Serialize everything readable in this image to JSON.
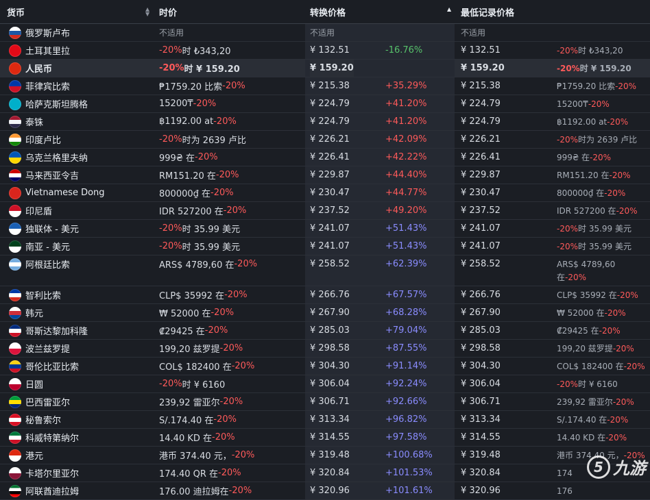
{
  "header": {
    "currency": "货币",
    "price": "时价",
    "converted": "转换价格",
    "lowest": "最低记录价格"
  },
  "rows": [
    {
      "name": "俄罗斯卢布",
      "price": "不适用",
      "converted": "不适用",
      "pct": "",
      "low": "不适用",
      "lowprice": "",
      "flag": "flag-russia",
      "flagcolors": [
        "#ffffff",
        "#1c57a5",
        "#d52b1e"
      ],
      "type": "na"
    },
    {
      "name": "土耳其里拉",
      "price_pct": "-20%",
      "price_rest": "时 ₺343,20",
      "converted": "¥ 132.51",
      "pct": "-16.76%",
      "pctclass": "green",
      "low": "¥ 132.51",
      "lowprice_pct": "-20%",
      "lowprice_rest": "时 ₺343,20",
      "flag": "flag-turkey",
      "flagcolors": [
        "#e30a17"
      ],
      "order": "pct-first"
    },
    {
      "name": "人民币",
      "price_pct": "-20%",
      "price_rest": "时 ¥ 159.20",
      "converted": "¥ 159.20",
      "pct": "",
      "pctclass": "",
      "low": "¥ 159.20",
      "lowprice_pct": "-20%",
      "lowprice_rest": "时 ¥ 159.20",
      "flag": "flag-china",
      "flagcolors": [
        "#de2910"
      ],
      "order": "pct-first",
      "highlight": true
    },
    {
      "name": "菲律宾比索",
      "price_rest": "₱1759.20 比索",
      "price_pct": "-20%",
      "converted": "¥ 215.38",
      "pct": "+35.29%",
      "pctclass": "red",
      "low": "¥ 215.38",
      "lowprice_rest": "₱1759.20 比索",
      "lowprice_pct": "-20%",
      "flag": "flag-philippines",
      "flagcolors": [
        "#0038a8",
        "#ce1126"
      ],
      "order": "pct-last"
    },
    {
      "name": "哈萨克斯坦腾格",
      "price_rest": "15200₸ ",
      "price_pct": "-20%",
      "converted": "¥ 224.79",
      "pct": "+41.20%",
      "pctclass": "red",
      "low": "¥ 224.79",
      "lowprice_rest": "15200₸ ",
      "lowprice_pct": "-20%",
      "flag": "flag-kazakhstan",
      "flagcolors": [
        "#00afca"
      ],
      "order": "pct-last"
    },
    {
      "name": "泰铢",
      "price_rest": "฿1192.00 at ",
      "price_pct": "-20%",
      "converted": "¥ 224.79",
      "pct": "+41.20%",
      "pctclass": "red",
      "low": "¥ 224.79",
      "lowprice_rest": "฿1192.00 at ",
      "lowprice_pct": "-20%",
      "flag": "flag-thailand",
      "flagcolors": [
        "#a51931",
        "#f4f5f8",
        "#2d2a4a"
      ],
      "order": "pct-last"
    },
    {
      "name": "印度卢比",
      "price_pct": "-20%",
      "price_rest": "时为 2639 卢比",
      "converted": "¥ 226.21",
      "pct": "+42.09%",
      "pctclass": "red",
      "low": "¥ 226.21",
      "lowprice_pct": "-20%",
      "lowprice_rest": "时为 2639 卢比",
      "flag": "flag-india",
      "flagcolors": [
        "#ff9933",
        "#ffffff",
        "#138808"
      ],
      "order": "pct-first"
    },
    {
      "name": "乌克兰格里夫纳",
      "price_rest": "999₴ 在",
      "price_pct": "-20%",
      "converted": "¥ 226.41",
      "pct": "+42.22%",
      "pctclass": "red",
      "low": "¥ 226.41",
      "lowprice_rest": "999₴ 在",
      "lowprice_pct": "-20%",
      "flag": "flag-ukraine",
      "flagcolors": [
        "#0057b7",
        "#ffd700"
      ],
      "order": "pct-last"
    },
    {
      "name": "马来西亚令吉",
      "price_rest": "RM151.20 在",
      "price_pct": "-20%",
      "converted": "¥ 229.87",
      "pct": "+44.40%",
      "pctclass": "red",
      "low": "¥ 229.87",
      "lowprice_rest": "RM151.20 在",
      "lowprice_pct": "-20%",
      "flag": "flag-malaysia",
      "flagcolors": [
        "#cc0001",
        "#ffffff",
        "#010066"
      ],
      "order": "pct-last"
    },
    {
      "name": "Vietnamese Dong",
      "price_rest": "800000₫ 在",
      "price_pct": "-20%",
      "converted": "¥ 230.47",
      "pct": "+44.77%",
      "pctclass": "red",
      "low": "¥ 230.47",
      "lowprice_rest": "800000₫ 在",
      "lowprice_pct": "-20%",
      "flag": "flag-vietnam",
      "flagcolors": [
        "#da251d"
      ],
      "order": "pct-last"
    },
    {
      "name": "印尼盾",
      "price_rest": "IDR 527200 在",
      "price_pct": "-20%",
      "converted": "¥ 237.52",
      "pct": "+49.20%",
      "pctclass": "red",
      "low": "¥ 237.52",
      "lowprice_rest": "IDR 527200 在",
      "lowprice_pct": "-20%",
      "flag": "flag-indonesia",
      "flagcolors": [
        "#ce1126",
        "#ffffff"
      ],
      "order": "pct-last"
    },
    {
      "name": "独联体 - 美元",
      "price_pct": "-20%",
      "price_rest": "时 35.99 美元",
      "converted": "¥ 241.07",
      "pct": "+51.43%",
      "pctclass": "blue",
      "low": "¥ 241.07",
      "lowprice_pct": "-20%",
      "lowprice_rest": "时 35.99 美元",
      "flag": "flag-cis",
      "flagcolors": [
        "#1a5fb4",
        "#ffffff"
      ],
      "order": "pct-first"
    },
    {
      "name": "南亚 - 美元",
      "price_pct": "-20%",
      "price_rest": "时 35.99 美元",
      "converted": "¥ 241.07",
      "pct": "+51.43%",
      "pctclass": "blue",
      "low": "¥ 241.07",
      "lowprice_pct": "-20%",
      "lowprice_rest": "时 35.99 美元",
      "flag": "flag-south-asia",
      "flagcolors": [
        "#01411c",
        "#ffffff"
      ],
      "order": "pct-first"
    },
    {
      "name": "阿根廷比索",
      "price_rest": "ARS$ 4789,60 在",
      "price_pct": "-20%",
      "converted": "¥ 258.52",
      "pct": "+62.39%",
      "pctclass": "blue",
      "low": "¥ 258.52",
      "lowprice_rest": "ARS$ 4789,60 在",
      "lowprice_pct": "-20%",
      "flag": "flag-argentina",
      "flagcolors": [
        "#74acdf",
        "#ffffff",
        "#74acdf"
      ],
      "order": "pct-last",
      "tall": true
    },
    {
      "name": "智利比索",
      "price_rest": "CLP$ 35992 在",
      "price_pct": "-20%",
      "converted": "¥ 266.76",
      "pct": "+67.57%",
      "pctclass": "blue",
      "low": "¥ 266.76",
      "lowprice_rest": "CLP$ 35992 在",
      "lowprice_pct": "-20%",
      "flag": "flag-chile",
      "flagcolors": [
        "#0039a6",
        "#ffffff",
        "#d52b1e"
      ],
      "order": "pct-last"
    },
    {
      "name": "韩元",
      "price_rest": "₩ 52000 在",
      "price_pct": "-20%",
      "converted": "¥ 267.90",
      "pct": "+68.28%",
      "pctclass": "blue",
      "low": "¥ 267.90",
      "lowprice_rest": "₩ 52000 在",
      "lowprice_pct": "-20%",
      "flag": "flag-korea",
      "flagcolors": [
        "#ffffff",
        "#cd2e3a",
        "#0047a0"
      ],
      "order": "pct-last"
    },
    {
      "name": "哥斯达黎加科隆",
      "price_rest": "₡29425 在",
      "price_pct": "-20%",
      "converted": "¥ 285.03",
      "pct": "+79.04%",
      "pctclass": "blue",
      "low": "¥ 285.03",
      "lowprice_rest": "₡29425 在",
      "lowprice_pct": "-20%",
      "flag": "flag-costa-rica",
      "flagcolors": [
        "#002b7f",
        "#ffffff",
        "#ce1126"
      ],
      "order": "pct-last"
    },
    {
      "name": "波兰兹罗提",
      "price_rest": "199,20 兹罗提",
      "price_pct": "-20%",
      "converted": "¥ 298.58",
      "pct": "+87.55%",
      "pctclass": "blue",
      "low": "¥ 298.58",
      "lowprice_rest": "199,20 兹罗提",
      "lowprice_pct": "-20%",
      "flag": "flag-poland",
      "flagcolors": [
        "#ffffff",
        "#dc143c"
      ],
      "order": "pct-last"
    },
    {
      "name": "哥伦比亚比索",
      "price_rest": "COL$ 182400 在",
      "price_pct": "-20%",
      "converted": "¥ 304.30",
      "pct": "+91.14%",
      "pctclass": "blue",
      "low": "¥ 304.30",
      "lowprice_rest": "COL$ 182400 在",
      "lowprice_pct": "-20%",
      "flag": "flag-colombia",
      "flagcolors": [
        "#fcd116",
        "#003893",
        "#ce1126"
      ],
      "order": "pct-last"
    },
    {
      "name": "日圆",
      "price_pct": "-20%",
      "price_rest": "时 ¥ 6160",
      "converted": "¥ 306.04",
      "pct": "+92.24%",
      "pctclass": "blue",
      "low": "¥ 306.04",
      "lowprice_pct": "-20%",
      "lowprice_rest": "时 ¥ 6160",
      "flag": "flag-japan",
      "flagcolors": [
        "#ffffff",
        "#bc002d"
      ],
      "order": "pct-first"
    },
    {
      "name": "巴西雷亚尔",
      "price_rest": "239,92 雷亚尔",
      "price_pct": "-20%",
      "converted": "¥ 306.71",
      "pct": "+92.66%",
      "pctclass": "blue",
      "low": "¥ 306.71",
      "lowprice_rest": "239,92 雷亚尔",
      "lowprice_pct": "-20%",
      "flag": "flag-brazil",
      "flagcolors": [
        "#009c3b",
        "#ffdf00",
        "#002776"
      ],
      "order": "pct-last"
    },
    {
      "name": "秘鲁索尔",
      "price_rest": "S/.174.40 在",
      "price_pct": "-20%",
      "converted": "¥ 313.34",
      "pct": "+96.82%",
      "pctclass": "blue",
      "low": "¥ 313.34",
      "lowprice_rest": "S/.174.40 在",
      "lowprice_pct": "-20%",
      "flag": "flag-peru",
      "flagcolors": [
        "#d91023",
        "#ffffff",
        "#d91023"
      ],
      "order": "pct-last"
    },
    {
      "name": "科威特第纳尔",
      "price_rest": "14.40 KD 在",
      "price_pct": "-20%",
      "converted": "¥ 314.55",
      "pct": "+97.58%",
      "pctclass": "blue",
      "low": "¥ 314.55",
      "lowprice_rest": "14.40 KD 在",
      "lowprice_pct": "-20%",
      "flag": "flag-kuwait",
      "flagcolors": [
        "#007a3d",
        "#ffffff",
        "#ce1126"
      ],
      "order": "pct-last"
    },
    {
      "name": "港元",
      "price_rest": "港币 374.40 元，",
      "price_pct": "-20%",
      "converted": "¥ 319.48",
      "pct": "+100.68%",
      "pctclass": "blue",
      "low": "¥ 319.48",
      "lowprice_rest": "港币 374.40 元，",
      "lowprice_pct": "-20%",
      "flag": "flag-hong-kong",
      "flagcolors": [
        "#de2910",
        "#ffffff"
      ],
      "order": "pct-last"
    },
    {
      "name": "卡塔尔里亚尔",
      "price_rest": "174.40 QR 在",
      "price_pct": "-20%",
      "converted": "¥ 320.84",
      "pct": "+101.53%",
      "pctclass": "blue",
      "low": "¥ 320.84",
      "lowprice_rest": "174",
      "lowprice_pct": "",
      "flag": "flag-qatar",
      "flagcolors": [
        "#ffffff",
        "#8a1538"
      ],
      "order": "pct-last"
    },
    {
      "name": "阿联酋迪拉姆",
      "price_rest": "176.00 迪拉姆在",
      "price_pct": "-20%",
      "converted": "¥ 320.96",
      "pct": "+101.61%",
      "pctclass": "blue",
      "low": "¥ 320.96",
      "lowprice_rest": "176",
      "lowprice_pct": "",
      "flag": "flag-uae",
      "flagcolors": [
        "#00732f",
        "#ffffff",
        "#000000",
        "#ff0000"
      ],
      "order": "pct-last"
    }
  ],
  "watermark": {
    "text": "九游",
    "glyph": "5"
  }
}
